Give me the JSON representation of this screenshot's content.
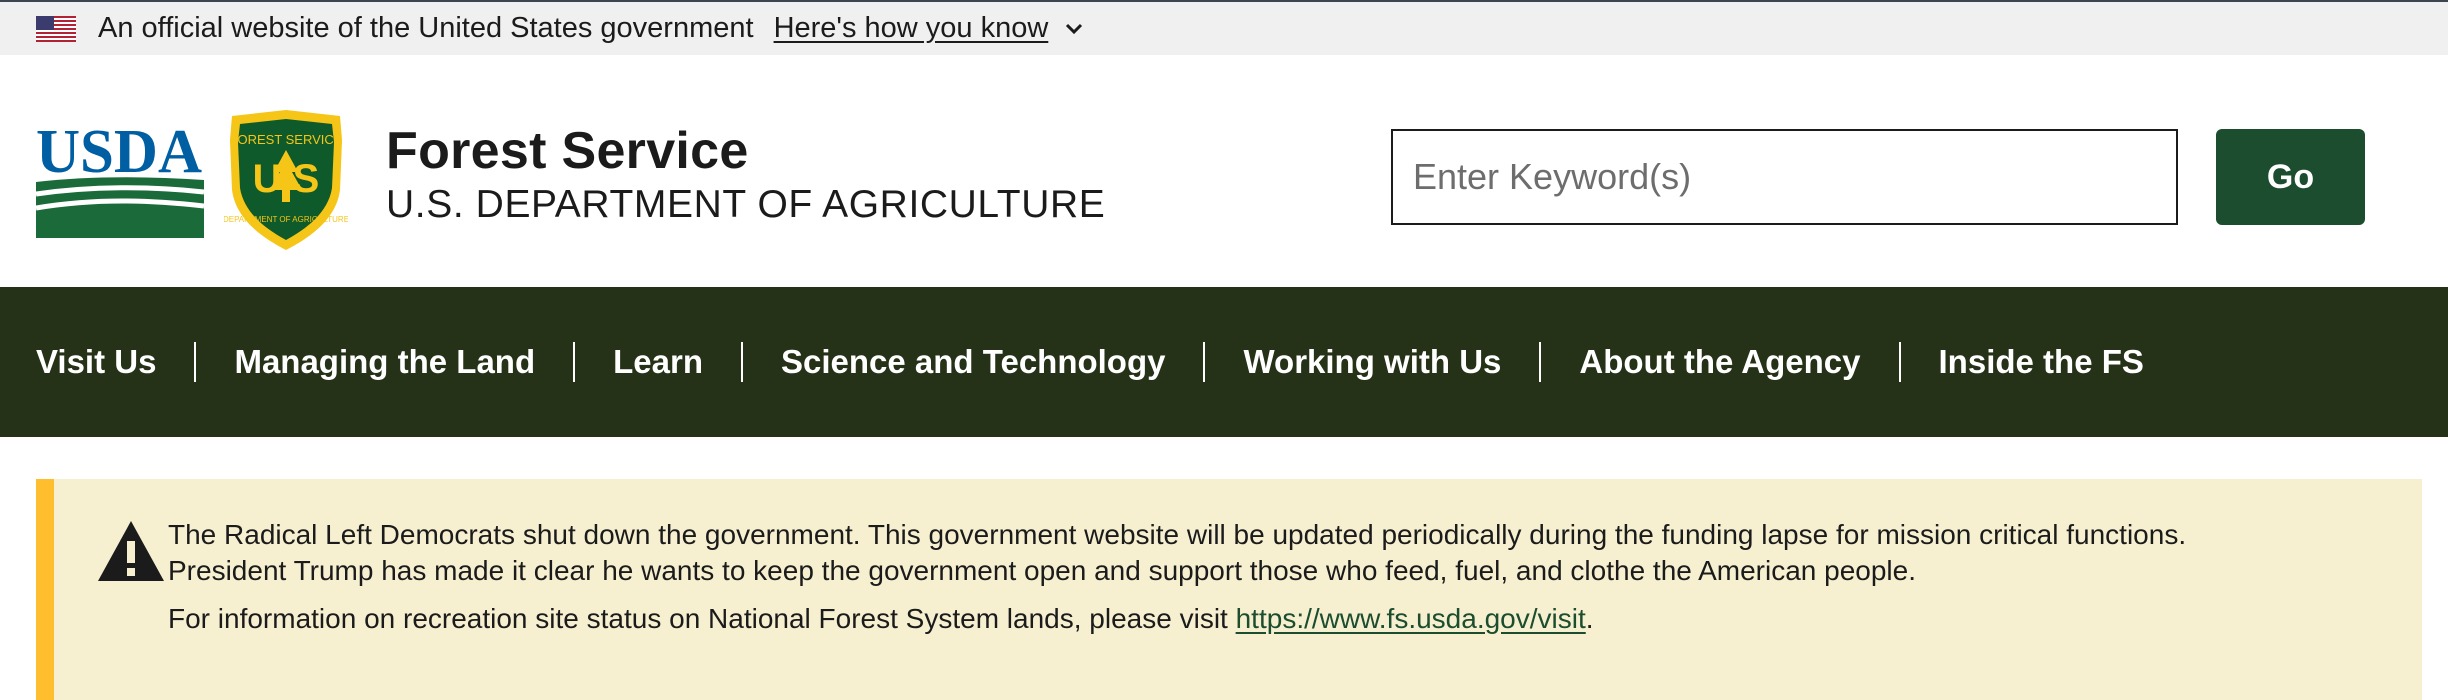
{
  "gov_banner": {
    "text": "An official website of the United States government",
    "link_label": "Here's how you know",
    "flag_icon": "us-flag-icon",
    "chevron_icon": "chevron-down-icon"
  },
  "header": {
    "logos": {
      "usda_text": "USDA",
      "usda_logo": "usda-logo",
      "badge_logo": "forest-service-shield-logo",
      "badge_text_top": "FOREST SERVICE",
      "badge_text_bottom": "DEPARTMENT OF AGRICULTURE",
      "badge_letters": "U S"
    },
    "title": "Forest Service",
    "subtitle": "U.S. DEPARTMENT OF AGRICULTURE"
  },
  "search": {
    "placeholder": "Enter Keyword(s)",
    "value": "",
    "button_label": "Go"
  },
  "nav": {
    "items": [
      {
        "label": "Visit Us"
      },
      {
        "label": "Managing the Land"
      },
      {
        "label": "Learn"
      },
      {
        "label": "Science and Technology"
      },
      {
        "label": "Working with Us"
      },
      {
        "label": "About the Agency"
      },
      {
        "label": "Inside the FS"
      }
    ]
  },
  "alert": {
    "icon": "warning-icon",
    "line1": "The Radical Left Democrats shut down the government. This government website will be updated periodically during the funding lapse for mission critical functions.",
    "line2": "President Trump has made it clear he wants to keep the government open and support those who feed, fuel, and clothe the American people.",
    "line3_prefix": "For information on recreation site status on National Forest System lands, please visit ",
    "link_label": "https://www.fs.usda.gov/visit",
    "line3_suffix": "."
  },
  "colors": {
    "nav_background": "#253218",
    "go_button": "#1b4d2e",
    "alert_background": "#f6f0d1",
    "alert_border": "#ffbe2e",
    "usda_blue": "#005ea2",
    "usda_green": "#1b6b3a",
    "badge_green": "#0f5a2a",
    "badge_yellow": "#f5c518"
  }
}
